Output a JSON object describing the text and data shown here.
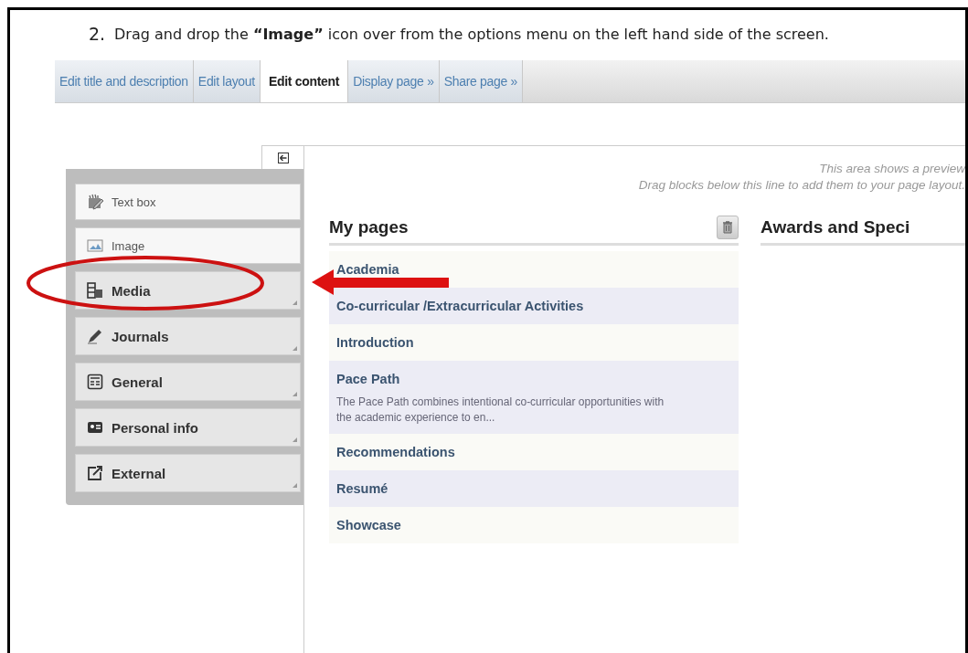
{
  "document": {
    "step_number": "2.",
    "instruction": "Drag and drop the **“Image”** icon over from the options menu on the left hand side of the screen."
  },
  "tabs": [
    {
      "label": "Edit title and description",
      "selected": false
    },
    {
      "label": "Edit layout",
      "selected": false
    },
    {
      "label": "Edit content",
      "selected": true
    },
    {
      "label": "Display page »",
      "selected": false
    },
    {
      "label": "Share page »",
      "selected": false
    }
  ],
  "palette": {
    "blocks": [
      {
        "label": "Text box",
        "kind": "single"
      },
      {
        "label": "Image",
        "kind": "single"
      },
      {
        "label": "Media",
        "kind": "group"
      },
      {
        "label": "Journals",
        "kind": "group"
      },
      {
        "label": "General",
        "kind": "group"
      },
      {
        "label": "Personal info",
        "kind": "group"
      },
      {
        "label": "External",
        "kind": "group"
      }
    ]
  },
  "preview": {
    "hint_lines": [
      "This area shows a preview",
      "Drag blocks below this line to add them to your page layout."
    ],
    "columns": [
      {
        "title": "My pages",
        "rows": [
          {
            "title": "Academia"
          },
          {
            "title": "Co-curricular /Extracurricular Activities"
          },
          {
            "title": "Introduction"
          },
          {
            "title": "Pace Path",
            "description": "The Pace Path combines intentional co-curricular opportunities with the academic experience to en..."
          },
          {
            "title": "Recommendations"
          },
          {
            "title": "Resumé"
          },
          {
            "title": "Showcase"
          }
        ]
      },
      {
        "title": "Awards and Speci"
      }
    ]
  }
}
